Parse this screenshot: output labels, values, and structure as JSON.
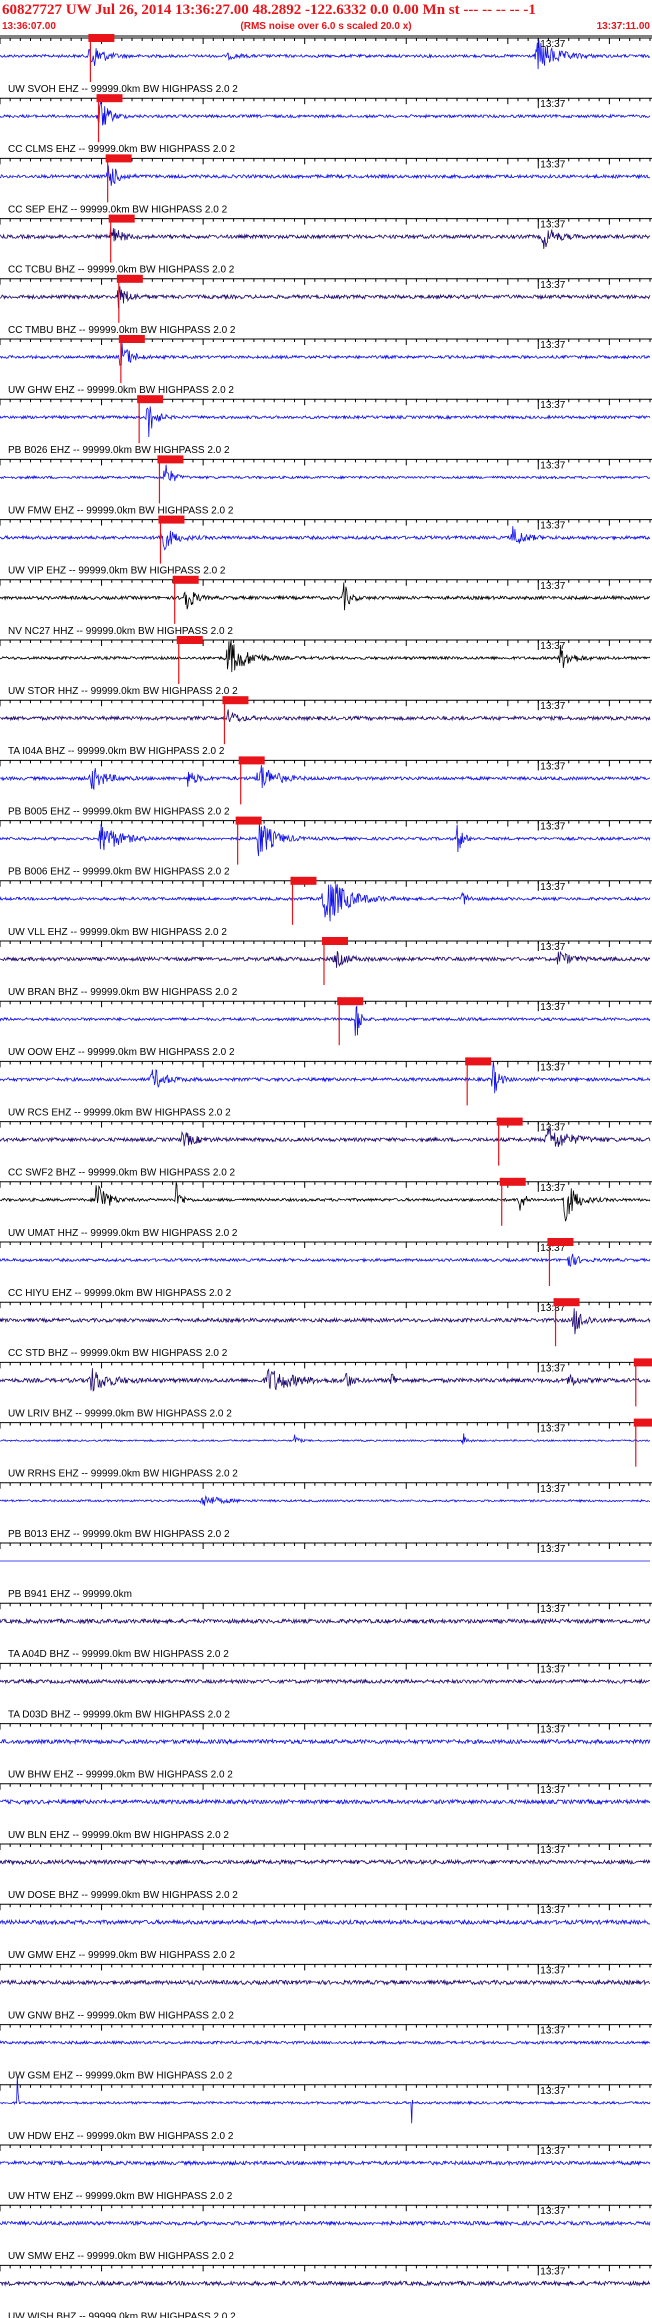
{
  "header": {
    "title": "60827727 UW Jul 26, 2014 13:36:27.00   48.2892 -122.6332  0.0 0.00 Mn st --- -- -- --  -1",
    "start_time": "13:36:07.00",
    "note": "(RMS noise over 6.0 s scaled 20.0 x)",
    "end_time": "13:37:11.00"
  },
  "minute_label": "13:37",
  "colors": {
    "blue": "#1111ee",
    "navy": "#200a6e",
    "black": "#000000",
    "pick": "#e8141a",
    "header": "#e8141a"
  },
  "chart_data": {
    "type": "seismogram",
    "x_unit": "seconds after 13:36:07.00",
    "xlim": [
      0,
      64
    ],
    "traces": [
      {
        "label": "UW SVOH EHZ -- 99999.0km BW  HIGHPASS  2.0  2",
        "color": "blue",
        "amp": 0.35,
        "pick": 8.9,
        "bursts": [
          [
            8.9,
            1.0,
            4
          ],
          [
            22.5,
            1.0,
            0.6
          ],
          [
            53,
            1.6,
            4
          ]
        ]
      },
      {
        "label": "CC CLMS EHZ -- 99999.0km BW  HIGHPASS  2.0  2",
        "color": "blue",
        "amp": 0.35,
        "pick": 9.7,
        "bursts": [
          [
            9.7,
            0.8,
            5
          ]
        ]
      },
      {
        "label": "CC SEP EHZ -- 99999.0km BW  HIGHPASS  2.0  2",
        "color": "blue",
        "amp": 0.4,
        "pick": 10.6,
        "bursts": [
          [
            10.6,
            0.8,
            4
          ]
        ]
      },
      {
        "label": "CC TCBU BHZ -- 99999.0km BW  HIGHPASS  2.0  2",
        "color": "navy",
        "amp": 0.45,
        "pick": 10.9,
        "bursts": [
          [
            10.9,
            0.8,
            3
          ],
          [
            53.5,
            1.0,
            3
          ]
        ]
      },
      {
        "label": "CC TMBU BHZ -- 99999.0km BW  HIGHPASS  2.0  2",
        "color": "navy",
        "amp": 0.45,
        "pick": 11.7,
        "bursts": [
          [
            11.7,
            0.8,
            3
          ]
        ]
      },
      {
        "label": "UW GHW EHZ -- 99999.0km BW  HIGHPASS  2.0  2",
        "color": "blue",
        "amp": 0.35,
        "pick": 11.9,
        "bursts": [
          [
            11.9,
            0.8,
            4
          ]
        ]
      },
      {
        "label": "PB B026 EHZ -- 99999.0km BW  HIGHPASS  2.0  2",
        "color": "blue",
        "amp": 0.35,
        "pick": 13.7,
        "bursts": [
          [
            14.5,
            0.6,
            6
          ]
        ]
      },
      {
        "label": "UW FMW EHZ -- 99999.0km BW  HIGHPASS  2.0  2",
        "color": "blue",
        "amp": 0.3,
        "pick": 15.7,
        "bursts": [
          [
            16.2,
            0.6,
            4
          ]
        ]
      },
      {
        "label": "UW VIP EHZ -- 99999.0km BW  HIGHPASS  2.0  2",
        "color": "blue",
        "amp": 0.4,
        "pick": 15.8,
        "bursts": [
          [
            15.8,
            1.0,
            4
          ],
          [
            50.5,
            1.0,
            2.5
          ]
        ]
      },
      {
        "label": "NV NC27 HHZ -- 99999.0km BW  HIGHPASS  2.0  2",
        "color": "black",
        "amp": 0.4,
        "pick": 17.2,
        "bursts": [
          [
            18.2,
            0.6,
            5
          ],
          [
            33.8,
            0.5,
            4
          ]
        ]
      },
      {
        "label": "UW STOR HHZ -- 99999.0km BW  HIGHPASS  2.0  2",
        "color": "black",
        "amp": 0.35,
        "pick": 17.6,
        "bursts": [
          [
            22.5,
            1.5,
            5
          ],
          [
            55.2,
            1.0,
            3
          ]
        ]
      },
      {
        "label": "TA I04A BHZ -- 99999.0km BW  HIGHPASS  2.0  2",
        "color": "navy",
        "amp": 0.45,
        "pick": 22.1,
        "bursts": [
          [
            22.5,
            0.8,
            2
          ]
        ]
      },
      {
        "label": "PB B005 EHZ -- 99999.0km BW  HIGHPASS  2.0  2",
        "color": "blue",
        "amp": 0.4,
        "pick": 23.7,
        "bursts": [
          [
            25.5,
            1.3,
            4
          ],
          [
            9,
            1.2,
            3
          ],
          [
            18.5,
            0.8,
            2
          ]
        ]
      },
      {
        "label": "PB B006 EHZ -- 99999.0km BW  HIGHPASS  2.0  2",
        "color": "blue",
        "amp": 0.35,
        "pick": 23.4,
        "bursts": [
          [
            25.5,
            1.3,
            5
          ],
          [
            10,
            1.5,
            4
          ],
          [
            45,
            0.5,
            4
          ]
        ]
      },
      {
        "label": "UW VLL EHZ -- 99999.0km BW  HIGHPASS  2.0  2",
        "color": "blue",
        "amp": 0.35,
        "pick": 28.8,
        "bursts": [
          [
            32,
            1.8,
            7
          ],
          [
            45.5,
            0.5,
            2
          ]
        ]
      },
      {
        "label": "UW BRAN BHZ -- 99999.0km BW  HIGHPASS  2.0  2",
        "color": "navy",
        "amp": 0.45,
        "pick": 31.9,
        "bursts": [
          [
            33,
            1.0,
            2
          ],
          [
            55,
            1.0,
            2
          ]
        ]
      },
      {
        "label": "UW OOW EHZ -- 99999.0km BW  HIGHPASS  2.0  2",
        "color": "blue",
        "amp": 0.35,
        "pick": 33.4,
        "bursts": [
          [
            35,
            0.3,
            9
          ]
        ]
      },
      {
        "label": "UW RCS EHZ -- 99999.0km BW  HIGHPASS  2.0  2",
        "color": "blue",
        "amp": 0.4,
        "pick": 46.0,
        "bursts": [
          [
            48.5,
            0.5,
            5
          ],
          [
            15,
            1.0,
            3
          ]
        ]
      },
      {
        "label": "CC SWF2 BHZ -- 99999.0km BW  HIGHPASS  2.0  2",
        "color": "navy",
        "amp": 0.45,
        "pick": 49.1,
        "bursts": [
          [
            54,
            1.8,
            3
          ],
          [
            18,
            1.0,
            2
          ]
        ]
      },
      {
        "label": "UW UMAT HHZ -- 99999.0km BW  HIGHPASS  2.0  2",
        "color": "black",
        "amp": 0.35,
        "pick": 49.4,
        "bursts": [
          [
            9.5,
            0.8,
            6
          ],
          [
            17.3,
            0.4,
            5
          ],
          [
            51,
            0.4,
            5
          ],
          [
            55.5,
            1.0,
            6
          ]
        ]
      },
      {
        "label": "CC HIYU EHZ -- 99999.0km BW  HIGHPASS  2.0  2",
        "color": "blue",
        "amp": 0.35,
        "pick": 54.1,
        "bursts": [
          [
            56,
            0.8,
            2
          ]
        ]
      },
      {
        "label": "CC STD BHZ -- 99999.0km BW  HIGHPASS  2.0  2",
        "color": "navy",
        "amp": 0.45,
        "pick": 54.7,
        "bursts": [
          [
            56.5,
            0.8,
            4
          ]
        ]
      },
      {
        "label": "UW LRIV BHZ -- 99999.0km BW  HIGHPASS  2.0  2",
        "color": "navy",
        "amp": 0.5,
        "pick": 62.6,
        "bursts": [
          [
            9,
            1.5,
            3
          ],
          [
            26.5,
            2.0,
            3
          ],
          [
            34,
            0.4,
            3
          ],
          [
            38.5,
            0.3,
            3
          ],
          [
            56,
            0.6,
            2
          ]
        ]
      },
      {
        "label": "UW RRHS EHZ -- 99999.0km BW  HIGHPASS  2.0  2",
        "color": "blue",
        "amp": 0.2,
        "pick": 62.6,
        "bursts": [
          [
            45.5,
            0.3,
            3
          ],
          [
            29,
            0.3,
            2
          ]
        ]
      },
      {
        "label": "PB B013 EHZ -- 99999.0km BW  HIGHPASS  2.0  2",
        "color": "blue",
        "amp": 0.25,
        "pick": null,
        "bursts": [
          [
            20,
            1.5,
            1.5
          ]
        ]
      },
      {
        "label": "PB B941 EHZ -- 99999.0km",
        "color": "blue",
        "amp": 0.0,
        "pick": null,
        "bursts": []
      },
      {
        "label": "TA A04D BHZ -- 99999.0km BW  HIGHPASS  2.0  2",
        "color": "navy",
        "amp": 0.5,
        "pick": null,
        "bursts": []
      },
      {
        "label": "TA D03D BHZ -- 99999.0km BW  HIGHPASS  2.0  2",
        "color": "navy",
        "amp": 0.45,
        "pick": null,
        "bursts": []
      },
      {
        "label": "UW BHW EHZ -- 99999.0km BW  HIGHPASS  2.0  2",
        "color": "blue",
        "amp": 0.5,
        "pick": null,
        "bursts": []
      },
      {
        "label": "UW BLN EHZ -- 99999.0km BW  HIGHPASS  2.0  2",
        "color": "blue",
        "amp": 0.5,
        "pick": null,
        "bursts": []
      },
      {
        "label": "UW DOSE BHZ -- 99999.0km BW  HIGHPASS  2.0  2",
        "color": "navy",
        "amp": 0.5,
        "pick": null,
        "bursts": []
      },
      {
        "label": "UW GMW EHZ -- 99999.0km BW  HIGHPASS  2.0  2",
        "color": "blue",
        "amp": 0.5,
        "pick": null,
        "bursts": []
      },
      {
        "label": "UW GNW BHZ -- 99999.0km BW  HIGHPASS  2.0  2",
        "color": "navy",
        "amp": 0.5,
        "pick": null,
        "bursts": []
      },
      {
        "label": "UW GSM EHZ -- 99999.0km BW  HIGHPASS  2.0  2",
        "color": "blue",
        "amp": 0.35,
        "pick": null,
        "bursts": []
      },
      {
        "label": "UW HDW EHZ -- 99999.0km BW  HIGHPASS  2.0  2",
        "color": "blue",
        "amp": 0.3,
        "pick": null,
        "bursts": [
          [
            1.7,
            0.05,
            12
          ],
          [
            40.5,
            0.05,
            10
          ]
        ]
      },
      {
        "label": "UW HTW EHZ -- 99999.0km BW  HIGHPASS  2.0  2",
        "color": "blue",
        "amp": 0.45,
        "pick": null,
        "bursts": []
      },
      {
        "label": "UW SMW EHZ -- 99999.0km BW  HIGHPASS  2.0  2",
        "color": "blue",
        "amp": 0.45,
        "pick": null,
        "bursts": []
      },
      {
        "label": "UW WISH BHZ -- 99999.0km BW  HIGHPASS  2.0  2",
        "color": "navy",
        "amp": 0.5,
        "pick": null,
        "bursts": []
      }
    ]
  }
}
